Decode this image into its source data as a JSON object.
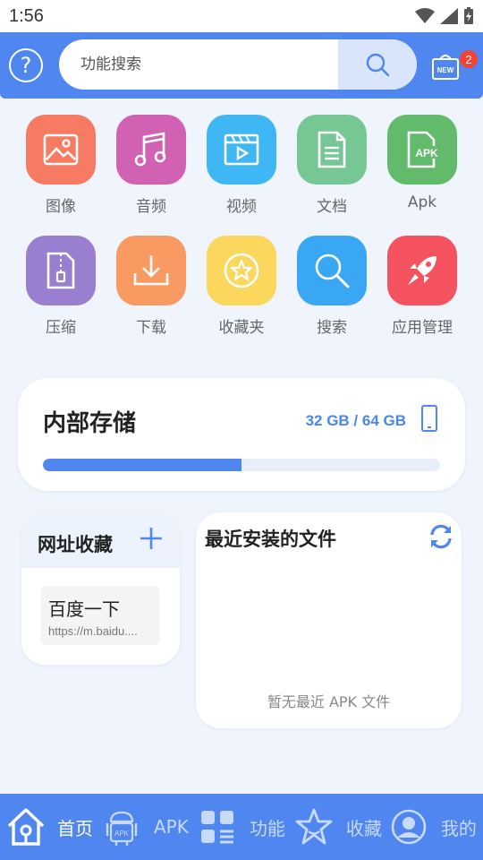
{
  "status": {
    "time": "1:56"
  },
  "header": {
    "help_icon": "question-circle-icon",
    "search_placeholder": "功能搜索",
    "new_badge": "2",
    "new_label": "NEW"
  },
  "apps": [
    {
      "label": "图像",
      "icon": "image-icon",
      "color": "#f77b62"
    },
    {
      "label": "音频",
      "icon": "music-icon",
      "color": "#d061b3"
    },
    {
      "label": "视频",
      "icon": "video-icon",
      "color": "#3fb7f4"
    },
    {
      "label": "文档",
      "icon": "document-icon",
      "color": "#77c794"
    },
    {
      "label": "Apk",
      "icon": "apk-icon",
      "color": "#62bb6a"
    },
    {
      "label": "压缩",
      "icon": "zip-icon",
      "color": "#9a7ed0"
    },
    {
      "label": "下载",
      "icon": "download-icon",
      "color": "#f89a62"
    },
    {
      "label": "收藏夹",
      "icon": "star-icon",
      "color": "#fbd75d"
    },
    {
      "label": "搜索",
      "icon": "search-icon",
      "color": "#3aa7f4"
    },
    {
      "label": "应用管理",
      "icon": "rocket-icon",
      "color": "#f4525f"
    }
  ],
  "storage": {
    "title": "内部存储",
    "size_text": "32 GB / 64 GB",
    "used_fraction": 0.5
  },
  "bookmarks": {
    "title": "网址收藏",
    "items": [
      {
        "title": "百度一下",
        "url": "https://m.baidu...."
      }
    ]
  },
  "recent": {
    "title": "最近安装的文件",
    "empty_text": "暂无最近 APK 文件"
  },
  "nav": [
    {
      "label": "首页",
      "icon": "home-icon",
      "active": true
    },
    {
      "label": "APK",
      "icon": "android-apk-icon",
      "active": false
    },
    {
      "label": "功能",
      "icon": "grid-icon",
      "active": false
    },
    {
      "label": "收藏",
      "icon": "star-icon",
      "active": false
    },
    {
      "label": "我的",
      "icon": "profile-icon",
      "active": false
    }
  ],
  "colors": {
    "primary": "#4f86f0",
    "inactive_nav": "#c9d9fa"
  }
}
